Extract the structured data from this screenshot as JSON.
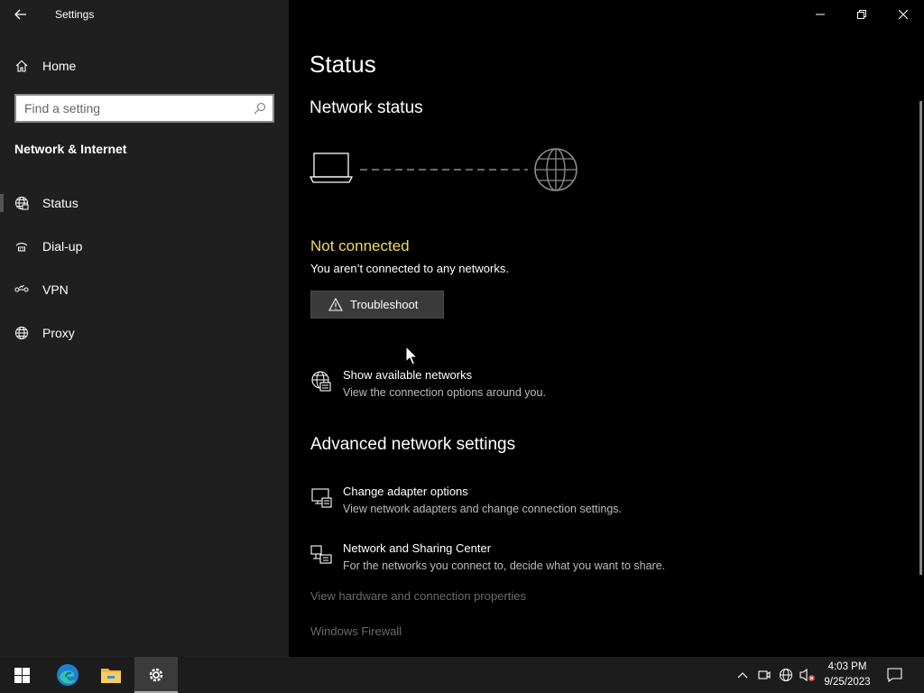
{
  "window": {
    "title": "Settings"
  },
  "sidebar": {
    "home_label": "Home",
    "search_placeholder": "Find a setting",
    "section_title": "Network & Internet",
    "items": [
      {
        "label": "Status",
        "icon": "globe-icon",
        "selected": true
      },
      {
        "label": "Dial-up",
        "icon": "dialup-icon"
      },
      {
        "label": "VPN",
        "icon": "vpn-icon"
      },
      {
        "label": "Proxy",
        "icon": "globe-icon"
      }
    ]
  },
  "main": {
    "page_title": "Status",
    "network_status_heading": "Network status",
    "status_headline": "Not connected",
    "status_description": "You aren’t connected to any networks.",
    "troubleshoot_label": "Troubleshoot",
    "show_networks": {
      "title": "Show available networks",
      "subtitle": "View the connection options around you."
    },
    "advanced_heading": "Advanced network settings",
    "adapter_options": {
      "title": "Change adapter options",
      "subtitle": "View network adapters and change connection settings."
    },
    "sharing_center": {
      "title": "Network and Sharing Center",
      "subtitle": "For the networks you connect to, decide what you want to share."
    },
    "hardware_properties_link": "View hardware and connection properties",
    "firewall_link": "Windows Firewall"
  },
  "taskbar": {
    "time": "4:03 PM",
    "date": "9/25/2023"
  },
  "colors": {
    "status_warning": "#f2d95f",
    "sidebar_bg": "#1f1f1f",
    "main_bg": "#000000",
    "taskbar_bg": "#1c1c1c"
  }
}
